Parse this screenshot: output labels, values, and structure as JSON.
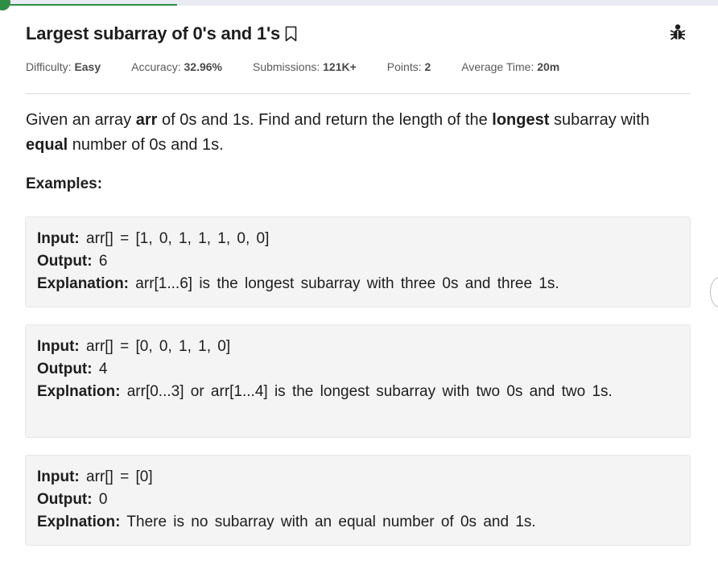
{
  "problem": {
    "title": "Largest subarray of 0's and 1's",
    "meta": {
      "difficulty_label": "Difficulty:",
      "difficulty_value": "Easy",
      "accuracy_label": "Accuracy:",
      "accuracy_value": "32.96%",
      "submissions_label": "Submissions:",
      "submissions_value": "121K+",
      "points_label": "Points:",
      "points_value": "2",
      "time_label": "Average Time:",
      "time_value": "20m"
    },
    "statement": {
      "t1": "Given an array ",
      "b1": "arr",
      "t2": " of 0s and 1s. Find and return the length of the ",
      "b2": "longest",
      "t3": " subarray with ",
      "b3": "equal",
      "t4": " number of 0s and 1s."
    },
    "examples_heading": "Examples:",
    "examples": [
      {
        "input_label": "Input:",
        "input_value": "arr[] = [1, 0, 1, 1, 1, 0, 0]",
        "output_label": "Output:",
        "output_value": "6",
        "explanation_label": "Explanation:",
        "explanation_value": "arr[1...6] is the longest subarray with three 0s and three 1s."
      },
      {
        "input_label": "Input:",
        "input_value": "arr[] = [0, 0, 1, 1, 0]",
        "output_label": "Output:",
        "output_value": "4",
        "explanation_label": "Explnation:",
        "explanation_value": "arr[0...3] or arr[1...4] is the longest subarray with two 0s and two 1s."
      },
      {
        "input_label": "Input:",
        "input_value": "arr[] = [0]",
        "output_label": "Output:",
        "output_value": "0",
        "explanation_label": "Explnation:",
        "explanation_value": "There is no subarray with an equal number of 0s and 1s."
      }
    ]
  },
  "icons": {
    "bookmark": "bookmark-icon",
    "bug": "bug-icon"
  },
  "colors": {
    "accent": "#2f8d46",
    "example_bg": "#f4f4f4",
    "text": "#1e1e1e"
  }
}
